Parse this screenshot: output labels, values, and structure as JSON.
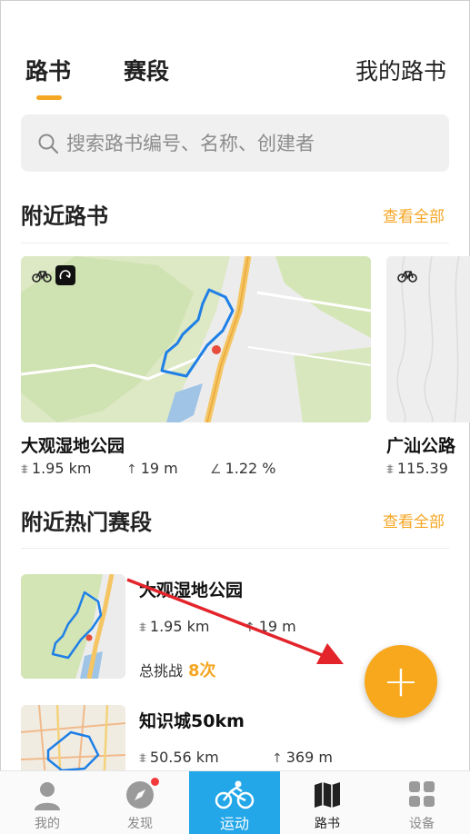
{
  "tabs": {
    "routes": "路书",
    "segments": "赛段",
    "my_routes": "我的路书"
  },
  "search": {
    "placeholder": "搜索路书编号、名称、创建者"
  },
  "nearby_routes": {
    "title": "附近路书",
    "see_all": "查看全部",
    "items": [
      {
        "name": "大观湿地公园",
        "distance": "1.95 km",
        "climb": "19 m",
        "grade": "1.22 %"
      },
      {
        "name": "广汕公路",
        "distance": "115.39"
      }
    ]
  },
  "popular_segments": {
    "title": "附近热门赛段",
    "see_all": "查看全部",
    "items": [
      {
        "name": "大观湿地公园",
        "distance": "1.95 km",
        "climb": "19 m",
        "challenge_label": "总挑战",
        "challenge_count": "8次"
      },
      {
        "name": "知识城50km",
        "distance": "50.56 km",
        "climb": "369 m"
      }
    ]
  },
  "fab": {
    "label": "+"
  },
  "bottom_nav": {
    "items": [
      {
        "label": "我的",
        "icon": "person-icon"
      },
      {
        "label": "发现",
        "icon": "compass-icon"
      },
      {
        "label": "运动",
        "icon": "bicycle-icon"
      },
      {
        "label": "路书",
        "icon": "map-book-icon"
      },
      {
        "label": "设备",
        "icon": "grid-icon"
      }
    ],
    "active_index": 2
  },
  "colors": {
    "accent": "#f5a623",
    "nav_active": "#23a7e8",
    "route_line": "#1e7fe6",
    "annotation_arrow": "#e3242b",
    "notification_dot": "#f23a3a"
  }
}
